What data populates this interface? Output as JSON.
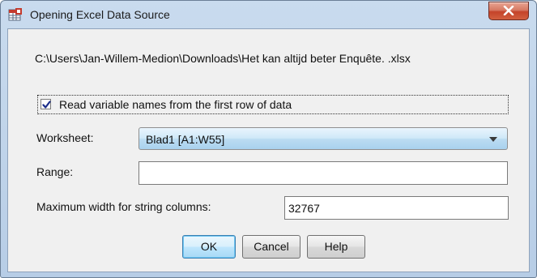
{
  "window": {
    "title": "Opening Excel Data Source",
    "icon": "spss-data-icon",
    "close_icon": "close-icon"
  },
  "file_path": "C:\\Users\\Jan-Willem-Medion\\Downloads\\Het kan altijd beter  Enquête. .xlsx",
  "read_names": {
    "label": "Read variable names from the first row of data",
    "checked": true
  },
  "worksheet": {
    "label": "Worksheet:",
    "selected": "Blad1 [A1:W55]"
  },
  "range": {
    "label": "Range:",
    "value": ""
  },
  "max_width": {
    "label": "Maximum width for string columns:",
    "value": "32767"
  },
  "buttons": {
    "ok": "OK",
    "cancel": "Cancel",
    "help": "Help"
  },
  "colors": {
    "title_bar": "#c9dbee",
    "close_button": "#c4432a",
    "dialog_bg": "#f0f0f0",
    "default_button_border": "#3c7fb1"
  }
}
